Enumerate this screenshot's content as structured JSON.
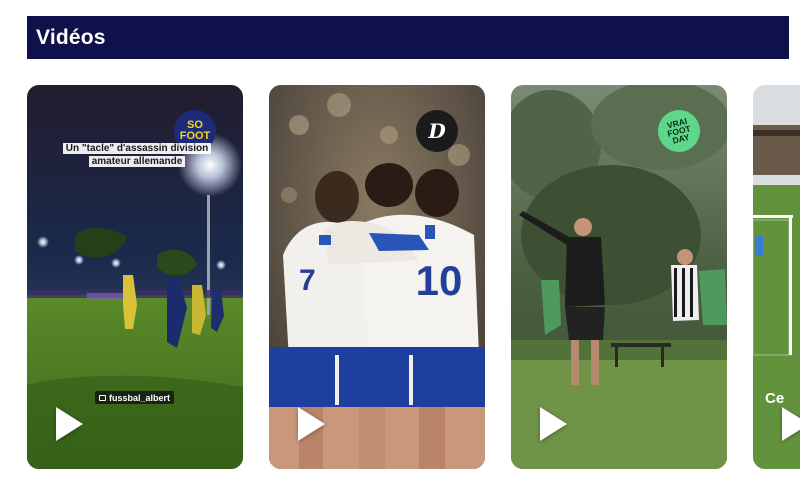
{
  "section": {
    "title": "Vidéos"
  },
  "videos": [
    {
      "caption": "Un \"tacle\" d'assassin division amateur allemande",
      "handle": "fussbal_albert",
      "badge_text": "SO FOOT",
      "badge_icon": "so-foot-logo",
      "play_icon": "play-icon"
    },
    {
      "badge_text": "D",
      "badge_icon": "d-logo",
      "play_icon": "play-icon",
      "jersey_number": "10"
    },
    {
      "badge_text": "VRAI FOOT DAY",
      "badge_icon": "vrai-foot-day-logo",
      "play_icon": "play-icon"
    },
    {
      "overlay_text": "Ce",
      "play_icon": "play-icon"
    }
  ],
  "colors": {
    "header_bg": "#10104a",
    "header_text": "#ffffff"
  }
}
